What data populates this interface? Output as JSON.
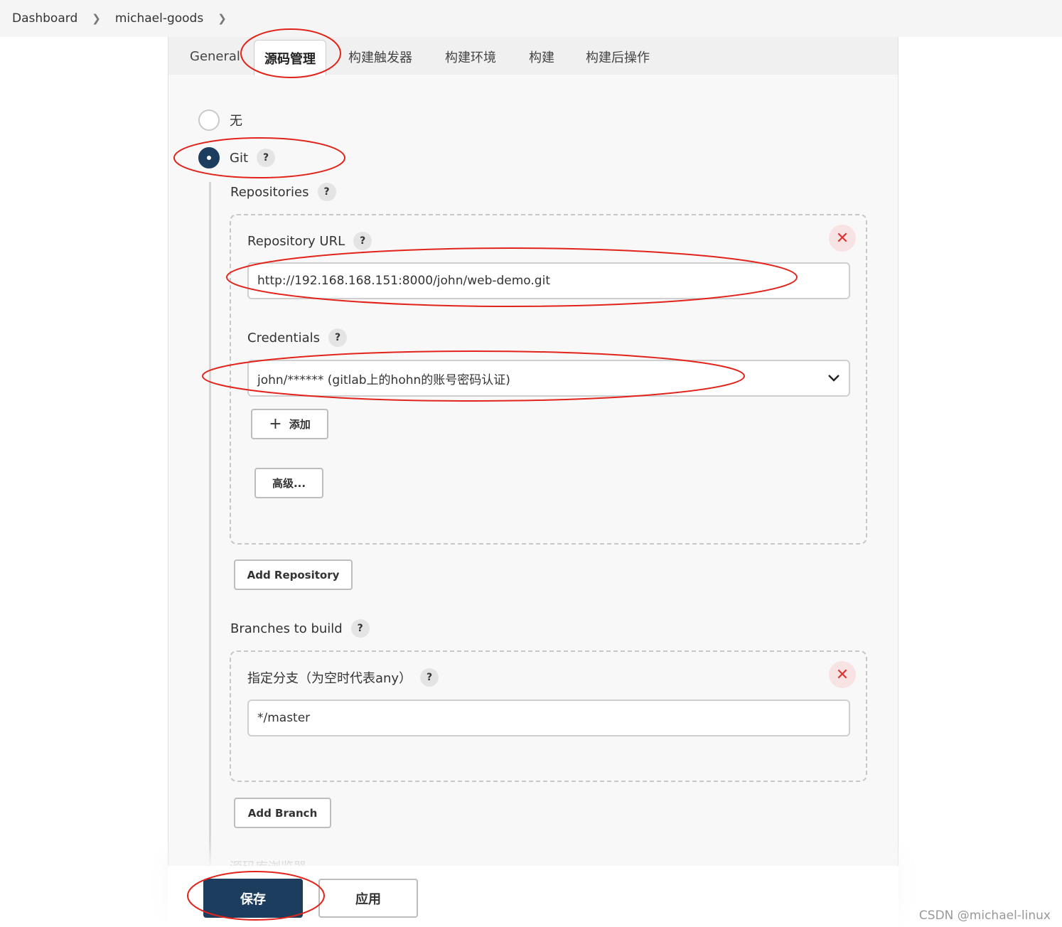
{
  "breadcrumb": {
    "items": [
      "Dashboard",
      "michael-goods"
    ]
  },
  "tabs": [
    {
      "label": "General",
      "active": false
    },
    {
      "label": "源码管理",
      "active": true
    },
    {
      "label": "构建触发器",
      "active": false
    },
    {
      "label": "构建环境",
      "active": false
    },
    {
      "label": "构建",
      "active": false
    },
    {
      "label": "构建后操作",
      "active": false
    }
  ],
  "scm": {
    "none_label": "无",
    "git_label": "Git",
    "selected": "Git",
    "help": "?"
  },
  "repositories": {
    "label": "Repositories",
    "url_label": "Repository URL",
    "url_value": "http://192.168.168.151:8000/john/web-demo.git",
    "credentials_label": "Credentials",
    "credentials_value": "john/****** (gitlab上的hohn的账号密码认证)",
    "add_label": "添加",
    "advanced_label": "高级...",
    "add_repository_label": "Add Repository",
    "close_glyph": "✕"
  },
  "branches": {
    "label": "Branches to build",
    "specifier_label": "指定分支（为空时代表any）",
    "specifier_value": "*/master",
    "add_branch_label": "Add Branch",
    "close_glyph": "✕"
  },
  "next_section": {
    "label": "源码库浏览器"
  },
  "footer": {
    "save_label": "保存",
    "apply_label": "应用"
  },
  "watermark": "CSDN @michael-linux",
  "colors": {
    "primary": "#1d3d5e",
    "annotation": "#e2231a",
    "close_bg": "#f7e3e3",
    "close_fg": "#dd3333"
  },
  "icons": {
    "breadcrumb_separator": "chevron-right-icon",
    "select_arrow": "chevron-down-icon",
    "close": "close-icon",
    "add": "plus-icon",
    "help": "help-icon"
  }
}
